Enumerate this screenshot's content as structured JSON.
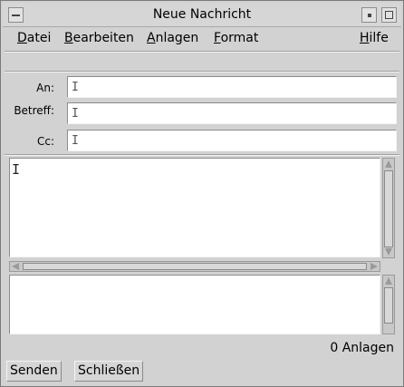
{
  "window": {
    "title": "Neue Nachricht"
  },
  "menu": {
    "datei": {
      "accel": "D",
      "rest": "atei"
    },
    "bearbeiten": {
      "accel": "B",
      "rest": "earbeiten"
    },
    "anlagen": {
      "accel": "A",
      "rest": "nlagen"
    },
    "format": {
      "accel": "F",
      "rest": "ormat"
    },
    "hilfe": {
      "accel": "H",
      "rest": "ilfe"
    }
  },
  "fields": {
    "to_label": "An:",
    "subject_label": "Betreff:",
    "cc_label": "Cc:",
    "to_value": "",
    "subject_value": "",
    "cc_value": ""
  },
  "attachments": {
    "count_text": "0 Anlagen"
  },
  "buttons": {
    "send": "Senden",
    "close": "Schließen"
  },
  "icons": {
    "window_menu": "window-menu-icon",
    "minimize": "minimize-icon",
    "maximize": "maximize-icon",
    "text_cursor": "text-cursor-icon"
  }
}
